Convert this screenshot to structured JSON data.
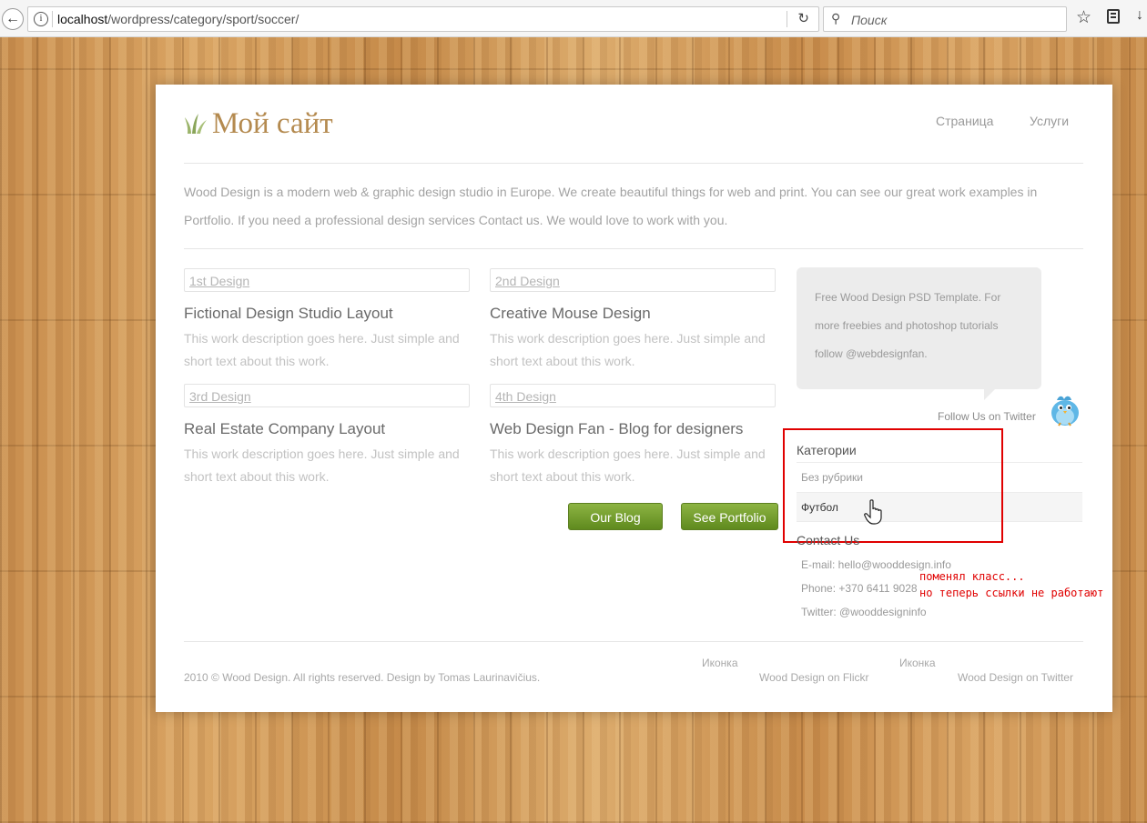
{
  "browser": {
    "url_host": "localhost",
    "url_path": "/wordpress/category/sport/soccer/",
    "search_placeholder": "Поиск"
  },
  "site": {
    "title": "Мой сайт",
    "nav": [
      "Страница",
      "Услуги"
    ],
    "intro": "Wood Design is a modern web & graphic design studio in Europe. We create beautiful things for web and print. You can see our great work examples in Portfolio. If you need a professional design services Contact us. We would love to work with you."
  },
  "works": [
    {
      "tag": "1st Design",
      "title": "Fictional Design Studio Layout",
      "desc": "This work description goes here. Just simple and short text about this work."
    },
    {
      "tag": "2nd Design",
      "title": "Creative Mouse Design",
      "desc": "This work description goes here. Just simple and short text about this work."
    },
    {
      "tag": "3rd Design",
      "title": "Real Estate Company Layout",
      "desc": "This work description goes here. Just simple and short text about this work."
    },
    {
      "tag": "4th Design",
      "title": "Web Design Fan - Blog for designers",
      "desc": "This work description goes here. Just simple and short text about this work."
    }
  ],
  "buttons": {
    "blog": "Our Blog",
    "portfolio": "See Portfolio"
  },
  "sidebar": {
    "tweet": "Free Wood Design PSD Template. For more freebies and photoshop tutorials follow @webdesignfan.",
    "follow": "Follow Us on Twitter",
    "categories_heading": "Категории",
    "categories": [
      "Без рубрики",
      "Футбол"
    ],
    "contact_heading": "Contact Us",
    "contact": [
      "E-mail: hello@wooddesign.info",
      "Phone: +370 6411 9028",
      "Twitter: @wooddesigninfo"
    ]
  },
  "footer": {
    "copyright": "2010 © Wood Design. All rights reserved. Design by Tomas Laurinavičius.",
    "icon_label": "Иконка",
    "flickr": "Wood Design on Flickr",
    "twitter": "Wood Design on Twitter"
  },
  "annotation": {
    "line1": "поменял класс...",
    "line2": "но теперь ссылки не работают"
  }
}
